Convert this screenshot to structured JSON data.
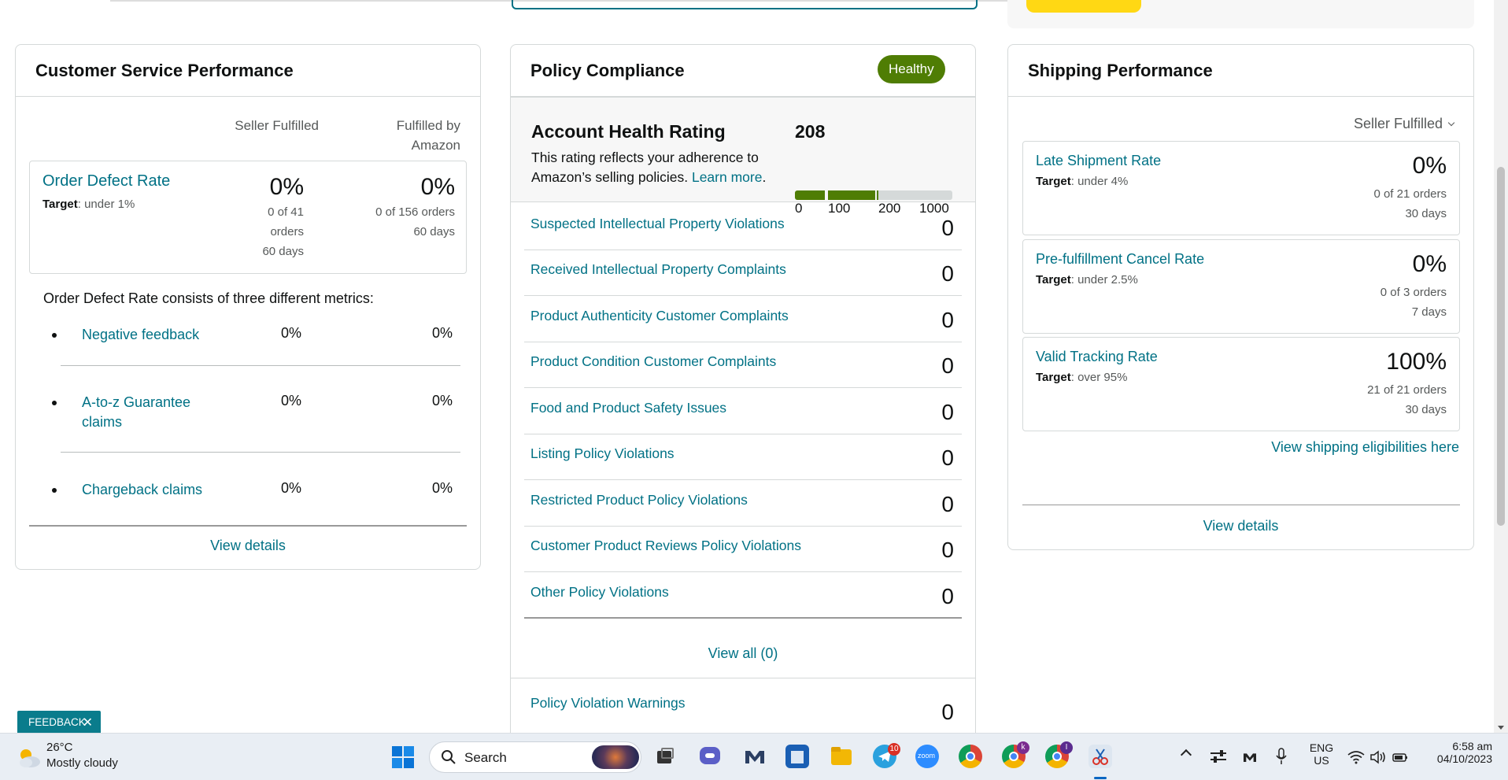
{
  "customer_service": {
    "title": "Customer Service Performance",
    "col_seller": "Seller Fulfilled",
    "col_amazon_line1": "Fulfilled by",
    "col_amazon_line2": "Amazon",
    "odr": {
      "title": "Order Defect Rate",
      "target_label": "Target",
      "target_value": ": under 1%",
      "seller_pct": "0%",
      "seller_line1": "0 of 41",
      "seller_line2": "orders",
      "seller_line3": "60 days",
      "amazon_pct": "0%",
      "amazon_line1": "0 of 156 orders",
      "amazon_line2": "60 days"
    },
    "description": "Order Defect Rate consists of three different metrics:",
    "metrics": [
      {
        "name": "Negative feedback",
        "seller": "0%",
        "amazon": "0%"
      },
      {
        "name": "A-to-z Guarantee claims",
        "seller": "0%",
        "amazon": "0%"
      },
      {
        "name": "Chargeback claims",
        "seller": "0%",
        "amazon": "0%"
      }
    ],
    "view_details": "View details"
  },
  "policy": {
    "title": "Policy Compliance",
    "status_badge": "Healthy",
    "ahr_title": "Account Health Rating",
    "ahr_desc": "This rating reflects your adherence to Amazon’s selling policies.",
    "ahr_learn_more": "Learn more",
    "ahr_desc_end": ".",
    "ahr_score": "208",
    "ahr_score_value": 208,
    "scale": [
      "0",
      "100",
      "200",
      "1000"
    ],
    "rows": [
      {
        "name": "Suspected Intellectual Property Violations",
        "value": "0"
      },
      {
        "name": "Received Intellectual Property Complaints",
        "value": "0"
      },
      {
        "name": "Product Authenticity Customer Complaints",
        "value": "0"
      },
      {
        "name": "Product Condition Customer Complaints",
        "value": "0"
      },
      {
        "name": "Food and Product Safety Issues",
        "value": "0"
      },
      {
        "name": "Listing Policy Violations",
        "value": "0"
      },
      {
        "name": "Restricted Product Policy Violations",
        "value": "0"
      },
      {
        "name": "Customer Product Reviews Policy Violations",
        "value": "0"
      },
      {
        "name": "Other Policy Violations",
        "value": "0"
      }
    ],
    "view_all": "View all (0)",
    "warnings": {
      "name": "Policy Violation Warnings",
      "value": "0"
    }
  },
  "shipping": {
    "title": "Shipping Performance",
    "selector": "Seller Fulfilled",
    "metrics": [
      {
        "name": "Late Shipment Rate",
        "target_label": "Target",
        "target_value": ": under 4%",
        "pct": "0%",
        "line1": "0 of 21 orders",
        "line2": "30 days"
      },
      {
        "name": "Pre-fulfillment Cancel Rate",
        "target_label": "Target",
        "target_value": ": under 2.5%",
        "pct": "0%",
        "line1": "0 of 3 orders",
        "line2": "7 days"
      },
      {
        "name": "Valid Tracking Rate",
        "target_label": "Target",
        "target_value": ": over 95%",
        "pct": "100%",
        "line1": "21 of 21 orders",
        "line2": "30 days"
      }
    ],
    "eligibility_link": "View shipping eligibilities here",
    "view_details": "View details"
  },
  "feedback": {
    "label": "FEEDBACK",
    "close": "✕"
  },
  "taskbar": {
    "weather_temp": "26°C",
    "weather_desc": "Mostly cloudy",
    "search_placeholder": "Search",
    "telegram_badge": "10",
    "chrome_k_badge": "k",
    "chrome_i_badge": "I",
    "lang_line1": "ENG",
    "lang_line2": "US",
    "time": "6:58 am",
    "date": "04/10/2023",
    "zoom_label": "zoom"
  }
}
